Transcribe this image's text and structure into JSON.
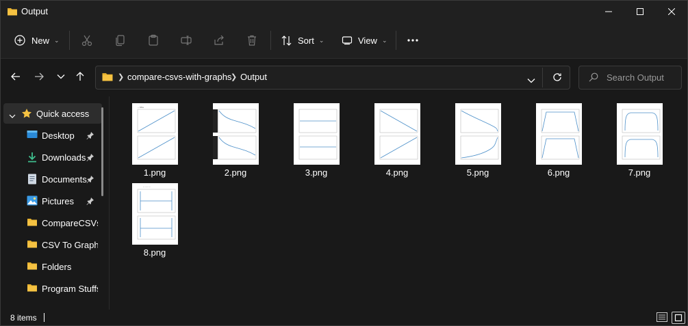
{
  "window": {
    "title": "Output"
  },
  "toolbar": {
    "new_label": "New",
    "sort_label": "Sort",
    "view_label": "View"
  },
  "address": {
    "crumbs": [
      "compare-csvs-with-graphs",
      "Output"
    ]
  },
  "search": {
    "placeholder": "Search Output"
  },
  "sidebar": {
    "items": [
      {
        "label": "Quick access"
      },
      {
        "label": "Desktop"
      },
      {
        "label": "Downloads"
      },
      {
        "label": "Documents"
      },
      {
        "label": "Pictures"
      },
      {
        "label": "CompareCSVsW"
      },
      {
        "label": "CSV To Graphs"
      },
      {
        "label": "Folders"
      },
      {
        "label": "Program Stuffs"
      }
    ]
  },
  "files": [
    {
      "name": "1.png"
    },
    {
      "name": "2.png"
    },
    {
      "name": "3.png"
    },
    {
      "name": "4.png"
    },
    {
      "name": "5.png"
    },
    {
      "name": "6.png"
    },
    {
      "name": "7.png"
    },
    {
      "name": "8.png"
    }
  ],
  "status": {
    "count": "8 items"
  },
  "colors": {
    "accent": "#60cdff",
    "folder": "#f5c242",
    "background": "#191919"
  }
}
